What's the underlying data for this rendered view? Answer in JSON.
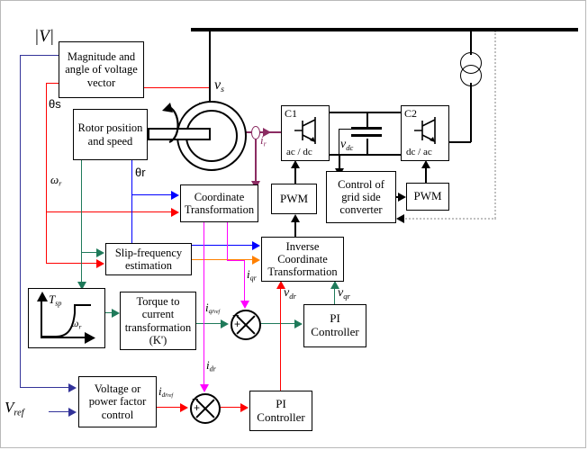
{
  "title": "DFIG vector control block diagram",
  "colors": {
    "black": "#000000",
    "red": "#ff0000",
    "blue": "#0000ff",
    "navy": "#333399",
    "green": "#1f7a5a",
    "magenta": "#ff00ff",
    "orange": "#ff8000",
    "purple": "#8b2c62",
    "gray_dotted": "#c0c0c0"
  },
  "blocks": {
    "magnitude_angle": "Magnitude and angle of voltage vector",
    "rotor_position": "Rotor position and speed",
    "coordinate_transformation": "Coordinate Transformation",
    "inverse_coordinate_transformation": "Inverse Coordinate Transformation",
    "slip_frequency": "Slip-frequency estimation",
    "torque_to_current": "Torque to current transformation (K')",
    "voltage_pf_control": "Voltage or power factor control",
    "pi_controller_q": "PI Controller",
    "pi_controller_d": "PI Controller",
    "pwm_rotor": "PWM",
    "pwm_grid": "PWM",
    "grid_side_control": "Control of grid side converter",
    "converter_c1_name": "C1",
    "converter_c1_mode": "ac / dc",
    "converter_c2_name": "C2",
    "converter_c2_mode": "dc / ac"
  },
  "signals": {
    "v_magnitude": "|V|",
    "theta_s": "θs",
    "theta_r": "θr",
    "omega_r": "ωr",
    "v_s": "vs",
    "i_r": "ir",
    "v_dc": "vdc",
    "i_qr_ref": "iqr ref",
    "i_qr": "iqr",
    "i_dr_ref": "idr ref",
    "i_dr": "idr",
    "v_dr": "vdr",
    "v_qr": "vqr",
    "v_ref": "Vref",
    "t_sp": "Tsp",
    "omega_r_curve": "ωr"
  }
}
